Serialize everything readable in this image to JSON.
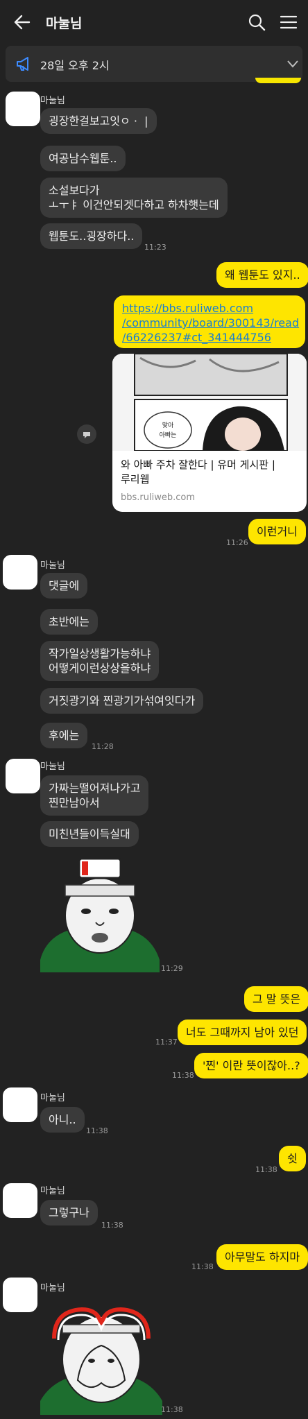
{
  "header": {
    "title": "마눌님",
    "back_icon": "back-arrow-icon",
    "search_icon": "search-icon",
    "menu_icon": "hamburger-menu-icon"
  },
  "notice": {
    "text": "28일 오후 2시",
    "icon": "megaphone-icon"
  },
  "colors": {
    "background": "#222222",
    "incoming_bubble": "#3a3a3a",
    "outgoing_bubble": "#fee500",
    "link": "#1a7fd0"
  },
  "messages": {
    "g1_sender": "마눌님",
    "m1": "굉장한걸보고잇ㅇ ·  |",
    "m2": "여공남수웹툰..",
    "m3": "소설보다가\nㅗㅜㅑ 이건안되겟다하고 하차햇는데",
    "m4": "웹툰도..굉장하다..",
    "t1": "11:23",
    "o1": "왜 웹툰도 있지..",
    "link": "https://bbs.ruliweb.com\n/community/board/300143/read\n/66226237#ct_341444756",
    "preview_title": "와 아빠 주차 잘한다 | 유머 게시판 |\n루리웹",
    "preview_url": "bbs.ruliweb.com",
    "o2": "이런거니",
    "t2": "11:26",
    "g2_sender": "마눌님",
    "m5": "댓글에",
    "m6": "초반에는",
    "m7": "작가일상생활가능하냐\n어떻게이런상상을하냐",
    "m8": "거짓광기와 찐광기가섞여잇다가",
    "m9": "후에는",
    "t3": "11:28",
    "g3_sender": "마눌님",
    "m10": "가짜는떨어져나가고\n찐만남아서",
    "m11": "미친년들이득실대",
    "t4": "11:29",
    "o3": "그 말 뜻은",
    "o4": "너도 그때까지 남아 있던",
    "t5": "11:37",
    "o5": "'찐' 이란 뜻이잖아..?",
    "t6": "11:38",
    "g4_sender": "마눌님",
    "m12": "아니..",
    "t7": "11:38",
    "o6": "쉿",
    "t8": "11:38",
    "g5_sender": "마눌님",
    "m13": "그렇구나",
    "t9": "11:38",
    "o7": "아무말도 하지마",
    "t10": "11:38",
    "g6_sender": "마눌님",
    "t11": "11:38"
  }
}
